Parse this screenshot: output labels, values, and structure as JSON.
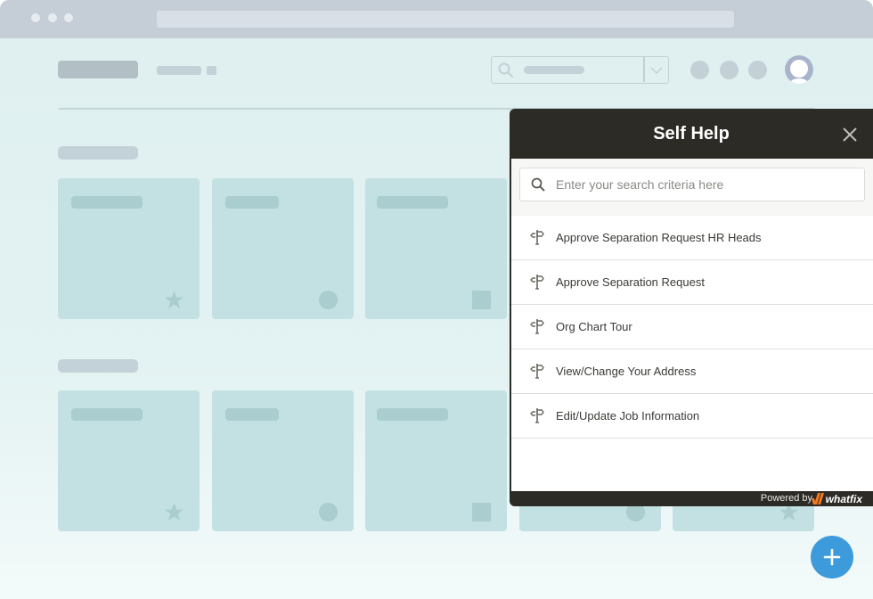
{
  "browser": {
    "window_controls": [
      "dot",
      "dot",
      "dot"
    ]
  },
  "app": {
    "header": {
      "search_placeholder_icon": "search-icon",
      "dropdown_icon": "chevron-down-icon",
      "header_icons": [
        "circle",
        "circle",
        "circle"
      ],
      "avatar_icon": "user-avatar-icon"
    },
    "sections": [
      {
        "cards": [
          {
            "shape": "star-icon"
          },
          {
            "shape": "circle-icon"
          },
          {
            "shape": "square-icon"
          }
        ]
      },
      {
        "cards": [
          {
            "shape": "star-icon"
          },
          {
            "shape": "circle-icon"
          },
          {
            "shape": "square-icon"
          },
          {
            "shape": "circle-icon"
          },
          {
            "shape": "star-icon"
          }
        ]
      }
    ]
  },
  "self_help": {
    "title": "Self Help",
    "close_icon": "close-icon",
    "search": {
      "value": "",
      "placeholder": "Enter your search criteria here"
    },
    "items": [
      {
        "label": "Approve Separation Request HR Heads",
        "icon": "signpost-icon"
      },
      {
        "label": "Approve Separation Request",
        "icon": "signpost-icon"
      },
      {
        "label": "Org Chart Tour",
        "icon": "signpost-icon"
      },
      {
        "label": "View/Change Your Address",
        "icon": "signpost-icon"
      },
      {
        "label": "Edit/Update Job Information",
        "icon": "signpost-icon"
      }
    ],
    "footer": {
      "powered_by": "Powered by",
      "brand": "whatfix"
    }
  },
  "fab": {
    "icon": "plus-icon"
  },
  "colors": {
    "panel_dark": "#2d2b26",
    "fab_blue": "#3d9bdb",
    "brand_orange": "#f47a20"
  }
}
